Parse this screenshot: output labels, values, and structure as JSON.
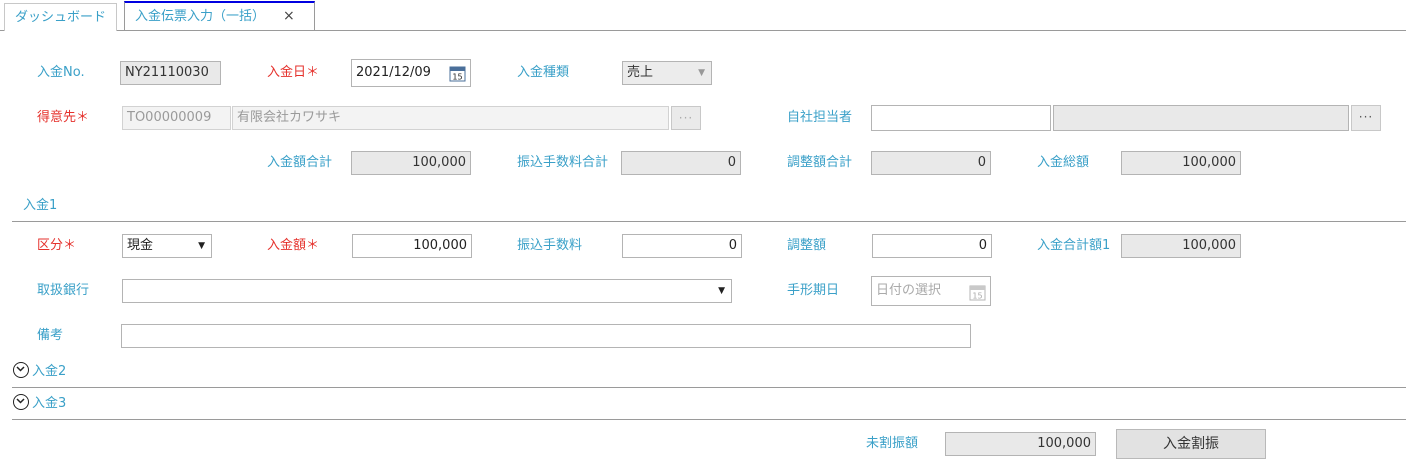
{
  "tabs": [
    {
      "label": "ダッシュボード"
    },
    {
      "label": "入金伝票入力（一括）",
      "close": "×"
    }
  ],
  "header": {
    "receipt_no_label": "入金No.",
    "receipt_no": "NY21110030",
    "receipt_date_label": "入金日",
    "receipt_date": "2021/12/09",
    "receipt_type_label": "入金種類",
    "receipt_type": "売上",
    "customer_label": "得意先",
    "customer_code": "TO00000009",
    "customer_name": "有限会社カワサキ",
    "more": "···",
    "staff_label": "自社担当者",
    "staff_code": "",
    "staff_name": "",
    "required_mark": "＊"
  },
  "totals": {
    "amount_total_label": "入金額合計",
    "amount_total": "100,000",
    "fee_total_label": "振込手数料合計",
    "fee_total": "0",
    "adjust_total_label": "調整額合計",
    "adjust_total": "0",
    "grand_total_label": "入金総額",
    "grand_total": "100,000"
  },
  "payment1": {
    "title": "入金1",
    "category_label": "区分",
    "category": "現金",
    "amount_label": "入金額",
    "amount": "100,000",
    "fee_label": "振込手数料",
    "fee": "0",
    "adjust_label": "調整額",
    "adjust": "0",
    "subtotal_label": "入金合計額1",
    "subtotal": "100,000",
    "bank_label": "取扱銀行",
    "bank": "",
    "bill_date_label": "手形期日",
    "bill_date_placeholder": "日付の選択",
    "memo_label": "備考",
    "memo": ""
  },
  "collapsed_sections": [
    {
      "title": "入金2"
    },
    {
      "title": "入金3"
    }
  ],
  "footer": {
    "unallocated_label": "未割振額",
    "unallocated": "100,000",
    "allocate_button": "入金割振"
  },
  "calendar_day": "15",
  "colors": {
    "label": "#3aa0c8",
    "required": "#e5322d",
    "active_tab": "#0000e0"
  }
}
